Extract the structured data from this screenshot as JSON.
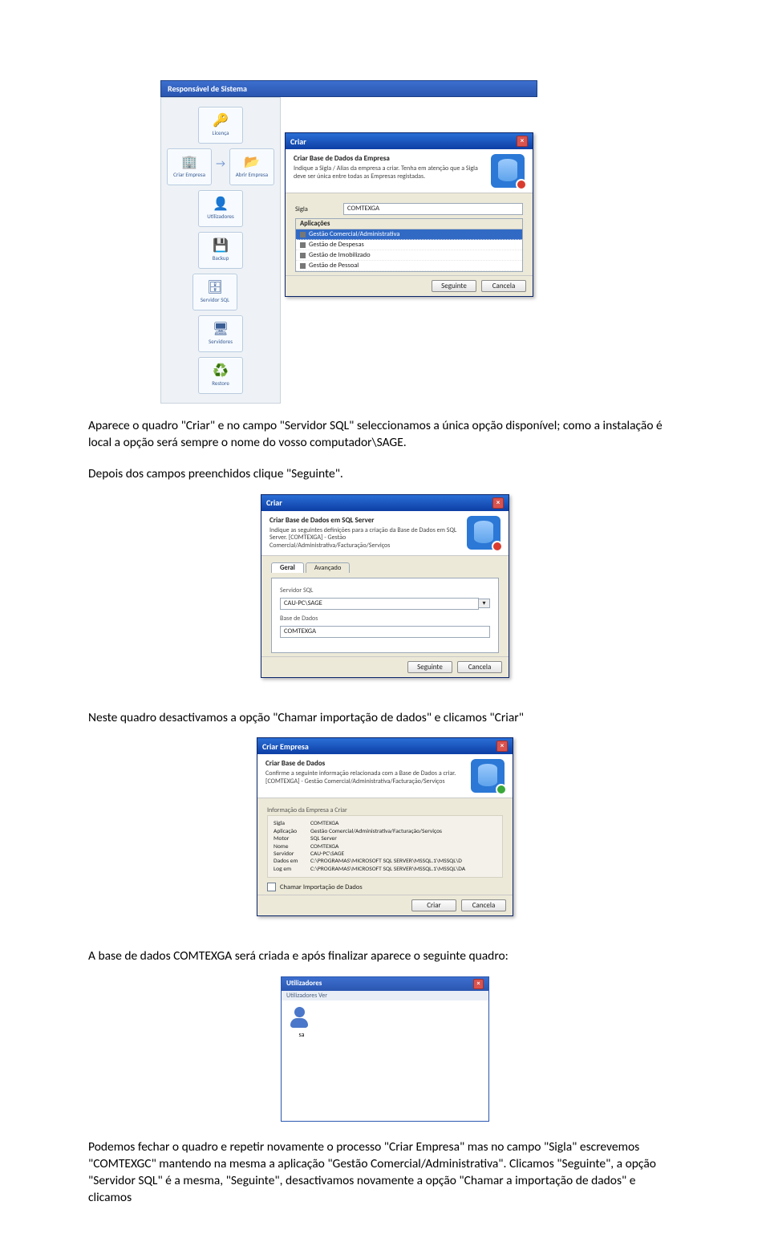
{
  "sys_panel": {
    "title": "Responsável de Sistema",
    "tiles": {
      "licenca": "Licença",
      "criar_empresa": "Criar Empresa",
      "abrir_empresa": "Abrir Empresa",
      "utilizadores": "Utilizadores",
      "backup": "Backup",
      "servidor_sql": "Servidor SQL",
      "servidores": "Servidores",
      "restore": "Restore"
    }
  },
  "dlg_criar": {
    "title": "Criar",
    "header_title": "Criar Base de Dados da Empresa",
    "header_sub": "Indique a Sigla / Alias da empresa a criar. Tenha em atenção que a Sigla deve ser única entre todas as Empresas registadas.",
    "field_sigla_label": "Sigla",
    "field_sigla_value": "COMTEXGA",
    "list_header": "Aplicações",
    "list_items": [
      "Gestão Comercial/Administrativa",
      "Gestão de Despesas",
      "Gestão de Imobilizado",
      "Gestão de Pessoal"
    ],
    "btn_next": "Seguinte",
    "btn_cancel": "Cancela"
  },
  "para1": "Aparece o quadro \"Criar\" e no campo \"Servidor SQL\" seleccionamos a única opção disponível; como a instalação é local a opção será sempre o nome do vosso computador\\SAGE.",
  "para2": "Depois dos campos preenchidos clique \"Seguinte\".",
  "dlg_sql": {
    "title": "Criar",
    "header_title": "Criar Base de Dados em SQL Server",
    "header_sub": "Indique as seguintes definições para a criação da Base de Dados em SQL Server. [COMTEXGA] - Gestão Comercial/Administrativa/Facturação/Serviços",
    "tab1": "Geral",
    "tab2": "Avançado",
    "srv_label": "Servidor SQL",
    "srv_value": "CAU-PC\\SAGE",
    "db_label": "Base de Dados",
    "db_value": "COMTEXGA",
    "btn_next": "Seguinte",
    "btn_cancel": "Cancela"
  },
  "para3": "Neste quadro desactivamos a opção \"Chamar importação de dados\" e clicamos \"Criar\"",
  "dlg_confirm": {
    "title": "Criar Empresa",
    "header_title": "Criar Base de Dados",
    "header_sub": "Confirme a seguinte informação relacionada com a Base de Dados a criar. [COMTEXGA] - Gestão Comercial/Administrativa/Facturação/Serviços",
    "info_title": "Informação da Empresa a Criar",
    "rows": {
      "sigla_k": "Sigla",
      "sigla_v": "COMTEXGA",
      "apl_k": "Aplicação",
      "apl_v": "Gestão Comercial/Administrativa/Facturação/Serviços",
      "motor_k": "Motor",
      "motor_v": "SQL Server",
      "nome_k": "Nome",
      "nome_v": "COMTEXGA",
      "srv_k": "Servidor",
      "srv_v": "CAU-PC\\SAGE",
      "dados_k": "Dados em",
      "dados_v": "C:\\PROGRAMAS\\MICROSOFT SQL SERVER\\MSSQL.1\\MSSQL\\D",
      "log_k": "Log em",
      "log_v": "C:\\PROGRAMAS\\MICROSOFT SQL SERVER\\MSSQL.1\\MSSQL\\DA"
    },
    "chk_label": "Chamar Importação de Dados",
    "btn_create": "Criar",
    "btn_cancel": "Cancela"
  },
  "para4": "A base de dados COMTEXGA será criada e após finalizar aparece o seguinte quadro:",
  "util": {
    "title": "Utilizadores",
    "menu": "Utilizadores   Ver",
    "user": "sa"
  },
  "para5": "Podemos fechar o quadro e repetir novamente o processo \"Criar Empresa\" mas no campo \"Sigla\" escrevemos \"COMTEXGC\" mantendo na mesma a aplicação \"Gestão Comercial/Administrativa\". Clicamos \"Seguinte\", a opção \"Servidor SQL\" é a mesma, \"Seguinte\", desactivamos novamente a opção \"Chamar a importação de dados\" e clicamos"
}
